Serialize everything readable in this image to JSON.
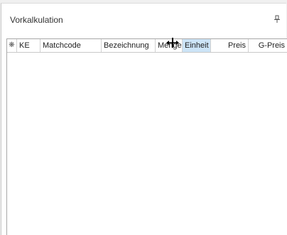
{
  "panel": {
    "title": "Vorkalkulation",
    "pin_icon": "pin-icon"
  },
  "grid": {
    "columns": [
      {
        "key": "star",
        "label": "❋"
      },
      {
        "key": "ke",
        "label": "KE"
      },
      {
        "key": "matchcode",
        "label": "Matchcode"
      },
      {
        "key": "bezeichnung",
        "label": "Bezeichnung"
      },
      {
        "key": "menge",
        "label": "Menge"
      },
      {
        "key": "einheit",
        "label": "Einheit",
        "selected": true
      },
      {
        "key": "preis",
        "label": "Preis"
      },
      {
        "key": "gpreis",
        "label": "G-Preis"
      }
    ],
    "rows": []
  },
  "cursor": {
    "icon": "column-resize-cursor-icon"
  },
  "colors": {
    "selected_header": "#cce4f7",
    "border": "#a8a8a8"
  }
}
